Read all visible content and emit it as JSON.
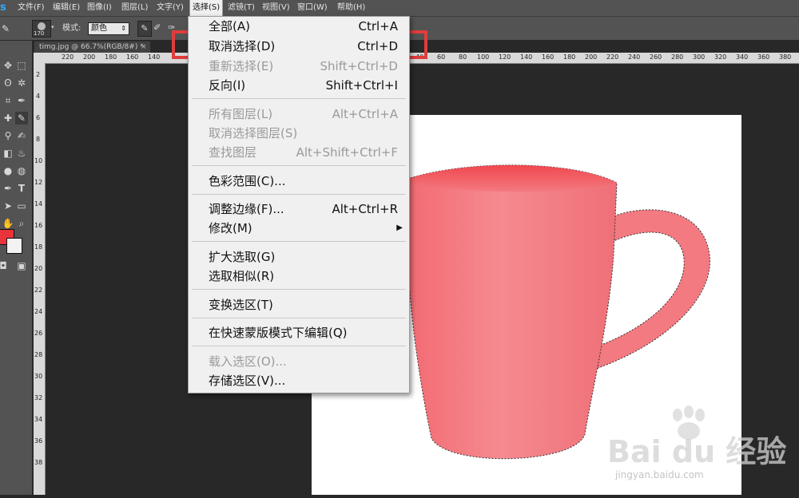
{
  "app": {
    "logo": "s",
    "menus": [
      "文件(F)",
      "编辑(E)",
      "图像(I)",
      "图层(L)",
      "文字(Y)",
      "选择(S)",
      "滤镜(T)",
      "视图(V)",
      "窗口(W)",
      "帮助(H)"
    ],
    "active_menu_index": 5
  },
  "options_bar": {
    "brush_size": "170",
    "mode_label": "模式:",
    "mode_value": "颜色"
  },
  "document": {
    "tab_title": "timg.jpg @ 66.7%(RGB/8#) *",
    "close_symbol": "×",
    "ruler_top_left": [
      "220",
      "200",
      "180",
      "160",
      "140"
    ],
    "ruler_top_right": [
      "40",
      "60",
      "80",
      "100",
      "120",
      "140",
      "160",
      "180",
      "200",
      "220",
      "240",
      "260",
      "280",
      "300",
      "320",
      "340",
      "360",
      "380",
      "400",
      "420"
    ],
    "ruler_left": [
      "2",
      "4",
      "6",
      "8",
      "10",
      "12",
      "14",
      "16",
      "18",
      "20",
      "22",
      "24",
      "26",
      "28",
      "30",
      "32",
      "34",
      "36",
      "38"
    ]
  },
  "select_menu": {
    "items": [
      {
        "label": "全部(A)",
        "shortcut": "Ctrl+A",
        "disabled": false
      },
      {
        "label": "取消选择(D)",
        "shortcut": "Ctrl+D",
        "disabled": false
      },
      {
        "label": "重新选择(E)",
        "shortcut": "Shift+Ctrl+D",
        "disabled": true
      },
      {
        "label": "反向(I)",
        "shortcut": "Shift+Ctrl+I",
        "disabled": false
      },
      {
        "label": "所有图层(L)",
        "shortcut": "Alt+Ctrl+A",
        "disabled": true
      },
      {
        "label": "取消选择图层(S)",
        "shortcut": "",
        "disabled": true
      },
      {
        "label": "查找图层",
        "shortcut": "Alt+Shift+Ctrl+F",
        "disabled": true
      },
      {
        "label": "色彩范围(C)...",
        "shortcut": "",
        "disabled": false
      },
      {
        "label": "调整边缘(F)...",
        "shortcut": "Alt+Ctrl+R",
        "disabled": false
      },
      {
        "label": "修改(M)",
        "shortcut": "",
        "disabled": false,
        "submenu": true
      },
      {
        "label": "扩大选取(G)",
        "shortcut": "",
        "disabled": false
      },
      {
        "label": "选取相似(R)",
        "shortcut": "",
        "disabled": false
      },
      {
        "label": "变换选区(T)",
        "shortcut": "",
        "disabled": false
      },
      {
        "label": "在快速蒙版模式下编辑(Q)",
        "shortcut": "",
        "disabled": false
      },
      {
        "label": "载入选区(O)...",
        "shortcut": "",
        "disabled": true
      },
      {
        "label": "存储选区(V)...",
        "shortcut": "",
        "disabled": false
      }
    ],
    "submenu_arrow": "▶"
  },
  "colors": {
    "foreground": "#e8343a",
    "background": "#f2f2f2",
    "highlight": "#e03c3c",
    "mug_main": "#f27a80",
    "mug_dark": "#ef6f77"
  },
  "watermark": {
    "text": "Bai du 经验",
    "url": "jingyan.baidu.com"
  }
}
